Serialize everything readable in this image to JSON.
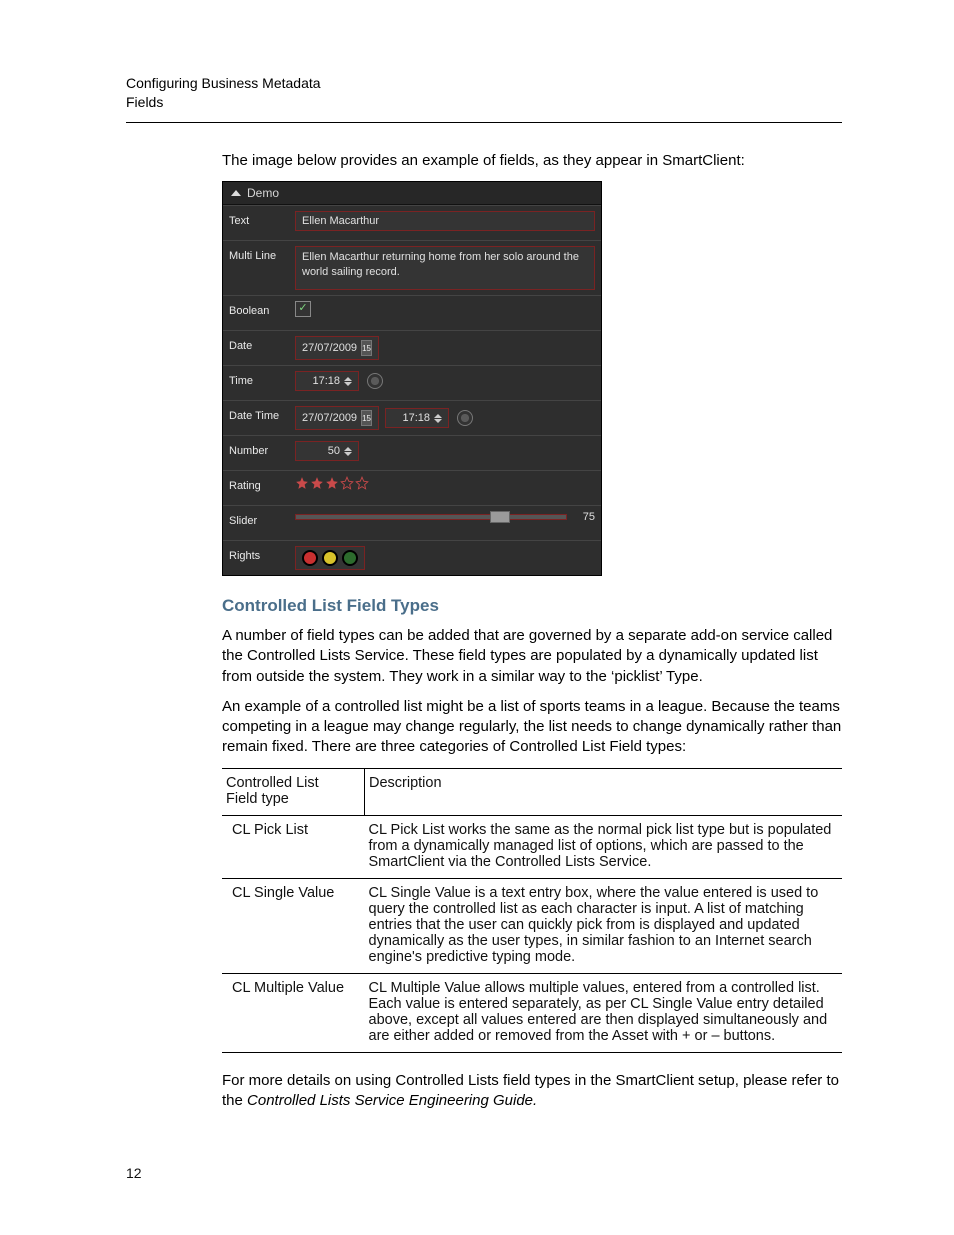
{
  "header": {
    "line1": "Configuring Business Metadata",
    "line2": "Fields"
  },
  "intro_text": "The image below provides an example of fields, as they appear in SmartClient:",
  "figure": {
    "panel_title": "Demo",
    "rows": {
      "text": {
        "label": "Text",
        "value": "Ellen Macarthur"
      },
      "multiline": {
        "label": "Multi Line",
        "value": "Ellen Macarthur returning home from her solo around the world sailing record."
      },
      "boolean": {
        "label": "Boolean",
        "checked": true
      },
      "date": {
        "label": "Date",
        "value": "27/07/2009"
      },
      "time": {
        "label": "Time",
        "value": "17:18"
      },
      "datetime": {
        "label": "Date Time",
        "date": "27/07/2009",
        "time": "17:18"
      },
      "number": {
        "label": "Number",
        "value": "50"
      },
      "rating": {
        "label": "Rating",
        "value": 3,
        "max": 5
      },
      "slider": {
        "label": "Slider",
        "value": 75,
        "max": 100
      },
      "rights": {
        "label": "Rights",
        "lights": [
          "red",
          "yellow",
          "green"
        ]
      }
    }
  },
  "section_title": "Controlled List Field Types",
  "para1": "A number of field types can be added that are governed by a separate add-on service called the Controlled Lists Service. These field types are populated by a dynamically updated list from outside the system. They work in a similar way to the ‘picklist’ Type.",
  "para2": "An example of a controlled list might be a list of sports teams in a league. Because the teams competing in a league may change regularly, the list needs to change dynamically rather than remain fixed. There are three categories of Controlled List Field types:",
  "table": {
    "head_col1_line1": "Controlled List",
    "head_col1_line2": "Field type",
    "head_col2": "Description",
    "rows": [
      {
        "type": "CL Pick List",
        "desc": "CL Pick List works the same as the normal pick list type but is populated from a dynamically managed list of options, which are passed to the SmartClient via the Controlled Lists Service."
      },
      {
        "type": "CL Single Value",
        "desc": "CL Single Value is a text entry box, where the value entered is used to query the controlled list as each character is input. A list of matching entries that the user can quickly pick from is displayed and updated dynamically as the user types, in similar fashion to an Internet search engine's predictive typing mode."
      },
      {
        "type": "CL Multiple Value",
        "desc": "CL Multiple Value allows multiple values, entered from a controlled list. Each value is entered separately, as per CL Single Value entry detailed above, except all values entered are then displayed simultaneously and are either added or removed from the Asset with + or – buttons."
      }
    ]
  },
  "closing_plain": "For more details on using Controlled Lists field types in the SmartClient setup, please refer to the ",
  "closing_italic": "Controlled Lists Service Engineering Guide.",
  "page_number": "12"
}
